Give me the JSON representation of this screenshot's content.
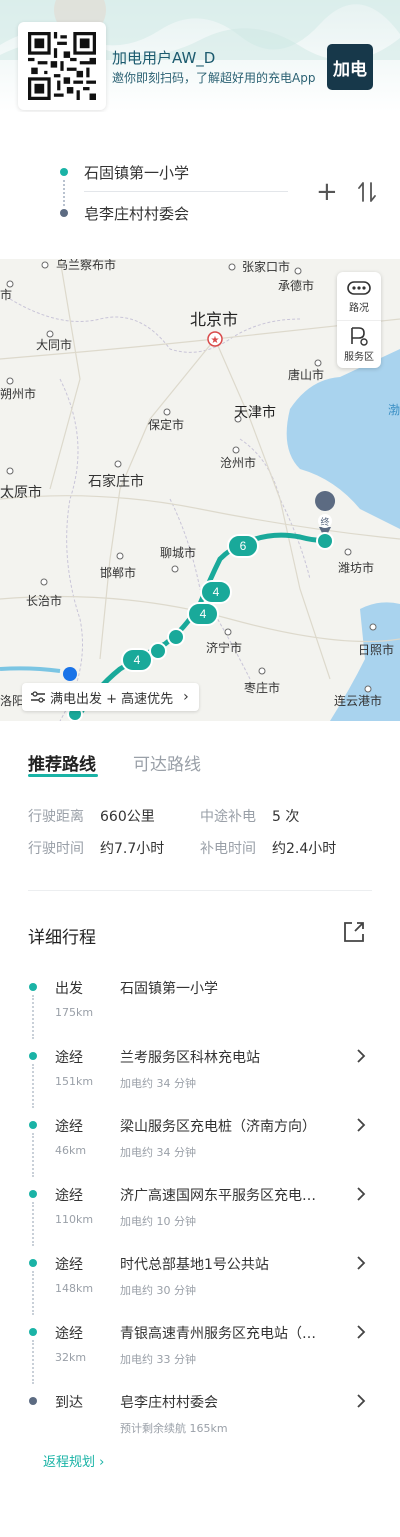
{
  "banner": {
    "title": "加电用户AW_D",
    "subtitle": "邀你即刻扫码，了解超好用的充电App",
    "app_logo_text": "加电"
  },
  "route": {
    "start": "石固镇第一小学",
    "end": "皂李庄村村委会",
    "add_icon": "plus-icon",
    "swap_icon": "swap-icon"
  },
  "map": {
    "cities": {
      "wulanchabu": "乌兰察布市",
      "shi": "市",
      "zhangjiakou": "张家口市",
      "chengde": "承德市",
      "beijing": "北京市",
      "datong": "大同市",
      "shuozhou": "朔州市",
      "tangshan": "唐山市",
      "baoding": "保定市",
      "tianjin": "天津市",
      "bohai": "渤",
      "cangzhou": "沧州市",
      "taiyuan": "太原市",
      "shijiazhuang": "石家庄市",
      "weifang": "潍坊市",
      "handan": "邯郸市",
      "liaocheng": "聊城市",
      "changzhi": "长治市",
      "jining": "济宁市",
      "rizhao": "日照市",
      "zaozhuang": "枣庄市",
      "luoyang": "洛阳",
      "lianyungang": "连云港市"
    },
    "stop_numbers": [
      "6",
      "4",
      "4",
      "4"
    ],
    "end_marker": "终",
    "controls": {
      "traffic": "路况",
      "service_area": "服务区"
    },
    "preference": "满电出发 + 高速优先"
  },
  "tabs": {
    "recommended": "推荐路线",
    "reachable": "可达路线"
  },
  "stats": {
    "distance_label": "行驶距离",
    "distance_value": "660公里",
    "charges_label": "中途补电",
    "charges_value": "5 次",
    "drive_time_label": "行驶时间",
    "drive_time_value": "约7.7小时",
    "charge_time_label": "补电时间",
    "charge_time_value": "约2.4小时"
  },
  "itinerary": {
    "title": "详细行程",
    "share_icon": "share-icon",
    "items": [
      {
        "type": "出发",
        "name": "石固镇第一小学",
        "km": "175km",
        "sub": ""
      },
      {
        "type": "途经",
        "name": "兰考服务区科林充电站",
        "km": "151km",
        "sub": "加电约 34 分钟"
      },
      {
        "type": "途经",
        "name": "梁山服务区充电桩（济南方向）",
        "km": "46km",
        "sub": "加电约 34 分钟"
      },
      {
        "type": "途经",
        "name": "济广高速国网东平服务区充电…",
        "km": "110km",
        "sub": "加电约 10 分钟"
      },
      {
        "type": "途经",
        "name": "时代总部基地1号公共站",
        "km": "148km",
        "sub": "加电约 30 分钟"
      },
      {
        "type": "途经",
        "name": "青银高速青州服务区充电站（…",
        "km": "32km",
        "sub": "加电约 33 分钟"
      },
      {
        "type": "到达",
        "name": "皂李庄村村委会",
        "km": "",
        "sub": "预计剩余续航 165km"
      }
    ],
    "return_link": "返程规划"
  },
  "colors": {
    "accent": "#1ab3a6",
    "end_dot": "#5c6b82",
    "logo_bg": "#17384a"
  }
}
